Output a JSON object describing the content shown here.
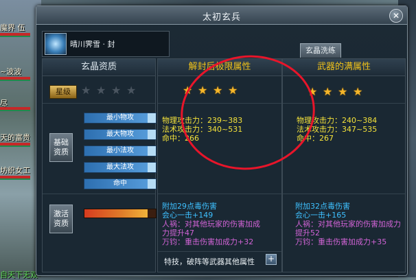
{
  "window": {
    "title": "太初玄兵",
    "close_glyph": "✕"
  },
  "item": {
    "name": "晴川霁雪 · 封"
  },
  "tab": {
    "label": "玄晶洗练"
  },
  "panels": {
    "gem_quality": {
      "header": "玄晶资质",
      "rank_label": "星级",
      "stars_on": 0,
      "stars_total": 4,
      "base_button": [
        "基础",
        "资质"
      ],
      "attr_rows": [
        "最小物攻",
        "最大物攻",
        "最小法攻",
        "最大法攻",
        "命中"
      ],
      "activate_button": [
        "激活",
        "资质"
      ],
      "activate_progress": 0.88
    },
    "unlock_limit": {
      "header": "解封后极限属性",
      "stars_on": 4,
      "stats": [
        "物理攻击力：239~383",
        "法术攻击力：340~531",
        "命中：266"
      ]
    },
    "weapon_max": {
      "header": "武器的满属性",
      "stars_on": 4,
      "stats": [
        "物理攻击力：240~384",
        "法术攻击力：347~535",
        "命中：267"
      ]
    }
  },
  "effects_mid": {
    "l1": "附加29点毒伤害",
    "l2": "会心一击+149",
    "l3": "人祸：对其他玩家的伤害加成",
    "l4": "力提升47",
    "l5": "万钧：重击伤害加成力+32"
  },
  "effects_right": {
    "l1": "附加32点毒伤害",
    "l2": "会心一击+165",
    "l3": "人祸：对其他玩家的伤害加成力",
    "l4": "提升52",
    "l5": "万钧：重击伤害加成力+35"
  },
  "bottom": {
    "label": "特技，破阵等武器其他属性",
    "plus_glyph": "+"
  },
  "background": {
    "left_names": [
      "魔界 伍",
      "~波波",
      "尽",
      "天的富贵",
      "坊织女工"
    ],
    "bottom_left_text": "自天下无双"
  },
  "colors": {
    "gold": "#f0c21a",
    "stat_yellow": "#f5e33a",
    "blue": "#3ec0ff",
    "purple": "#d163d6",
    "annotation_red": "#e8152a"
  }
}
